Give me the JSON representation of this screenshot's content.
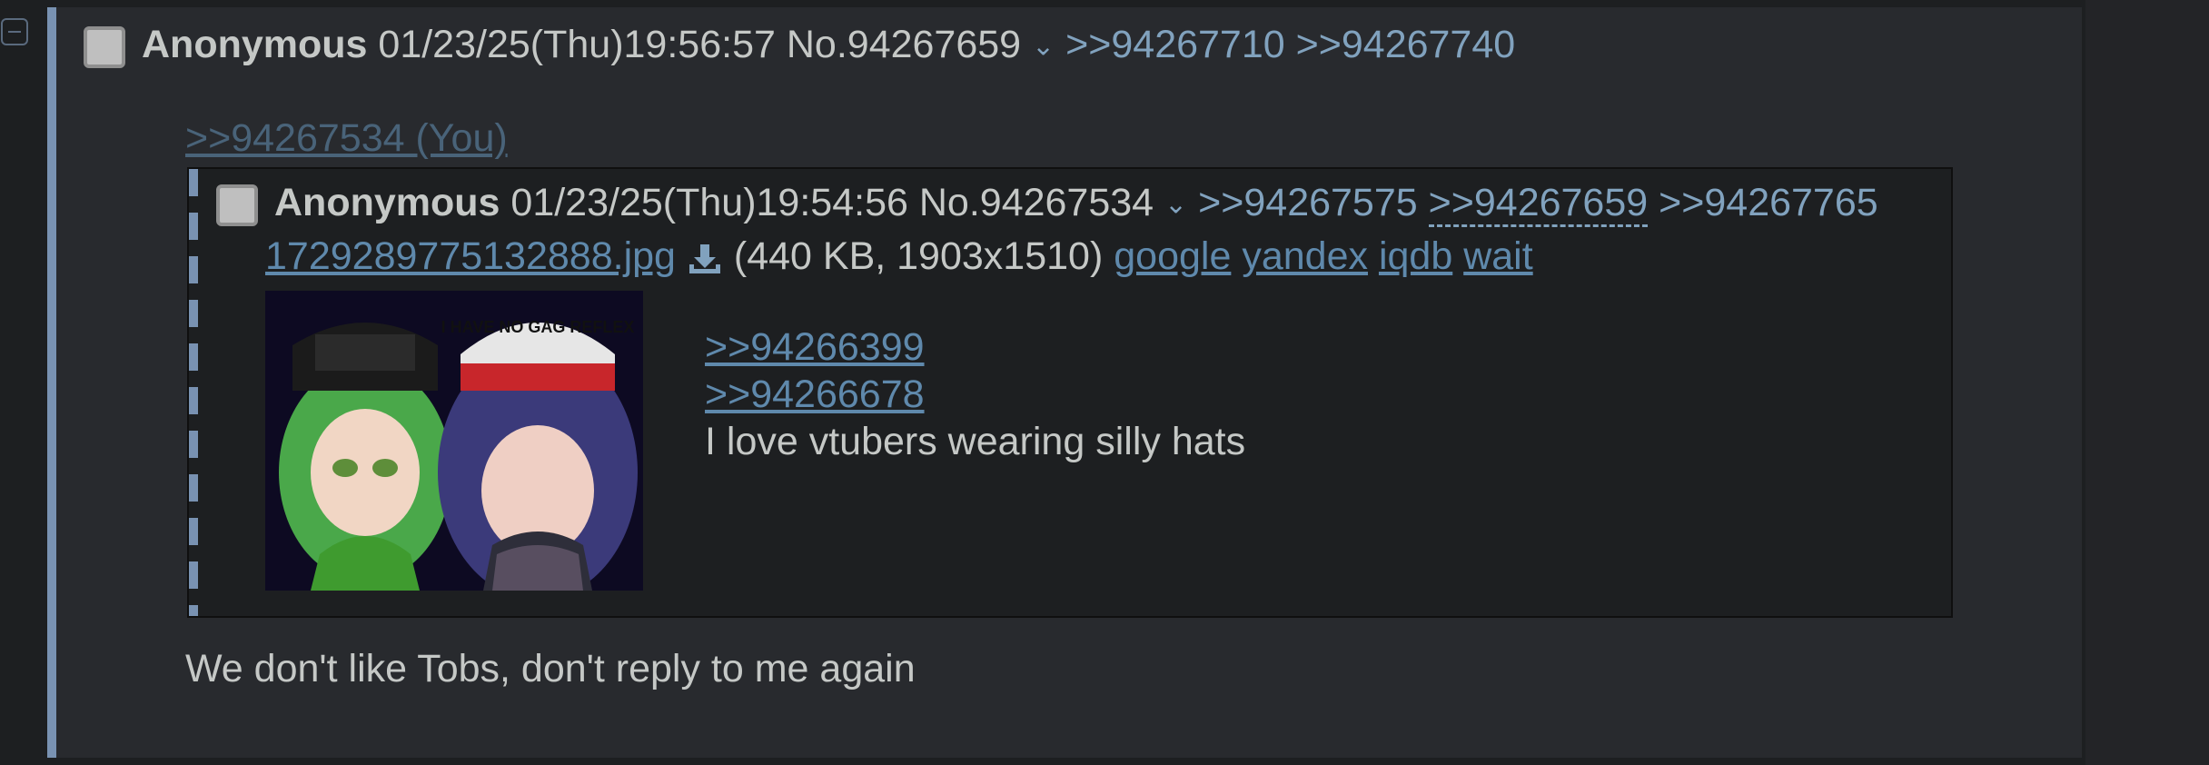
{
  "post": {
    "name": "Anonymous",
    "datetime": "01/23/25(Thu)19:56:57",
    "number": "No.94267659",
    "backlinks": [
      ">>94267710",
      ">>94267740"
    ],
    "quote_link": ">>94267534 (You)",
    "message": "We don't like Tobs, don't reply to me again"
  },
  "inline_post": {
    "name": "Anonymous",
    "datetime": "01/23/25(Thu)19:54:56",
    "number": "No.94267534",
    "backlinks": [
      ">>94267575",
      ">>94267659",
      ">>94267765"
    ],
    "file": {
      "filename": "1729289775132888.jpg",
      "meta": "(440 KB, 1903x1510)",
      "search_links": [
        "google",
        "yandex",
        "iqdb",
        "wait"
      ],
      "hat_text": "I HAVE NO GAG REFLEX"
    },
    "message_links": [
      ">>94266399",
      ">>94266678"
    ],
    "message": "I love vtubers wearing silly hats"
  },
  "colors": {
    "background": "#1d1f21",
    "post_bg": "#282a2e",
    "accent": "#7992b2",
    "link": "#81a2be",
    "text": "#c5c8c6"
  },
  "icons": [
    "collapse-icon",
    "checkbox-icon",
    "chevron-down-icon",
    "download-icon"
  ]
}
